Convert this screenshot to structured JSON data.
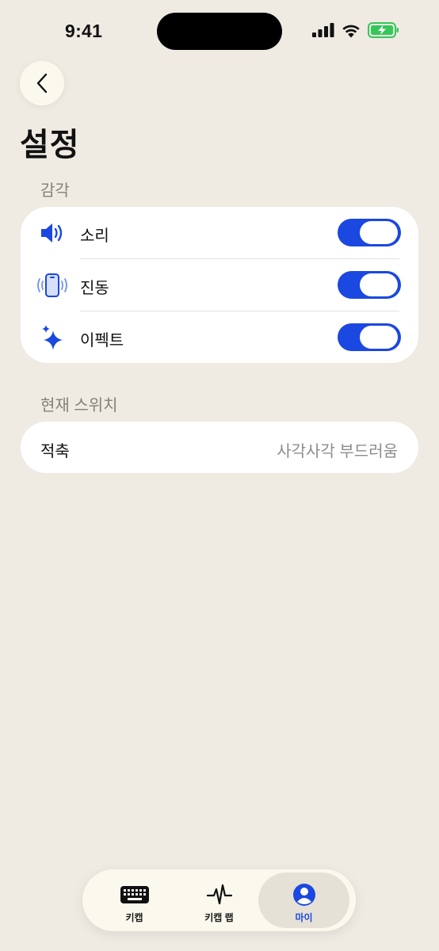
{
  "status_bar": {
    "time": "9:41"
  },
  "header": {
    "title": "설정"
  },
  "sections": {
    "sense": {
      "label": "감각",
      "items": [
        {
          "label": "소리",
          "icon": "speaker-icon",
          "enabled": true
        },
        {
          "label": "진동",
          "icon": "phone-vibrate-icon",
          "enabled": true
        },
        {
          "label": "이펙트",
          "icon": "sparkles-icon",
          "enabled": true
        }
      ]
    },
    "current_switch": {
      "label": "현재 스위치",
      "item": {
        "label": "적축",
        "value": "사각사각 부드러움"
      }
    }
  },
  "tab_bar": {
    "tabs": [
      {
        "label": "키캡",
        "icon": "keyboard-icon",
        "active": false
      },
      {
        "label": "키캡 랩",
        "icon": "waveform-icon",
        "active": false
      },
      {
        "label": "마이",
        "icon": "profile-icon",
        "active": true
      }
    ]
  },
  "colors": {
    "accent": "#1a48e0",
    "background": "#efebe3",
    "card": "#ffffff",
    "battery": "#34c759"
  }
}
